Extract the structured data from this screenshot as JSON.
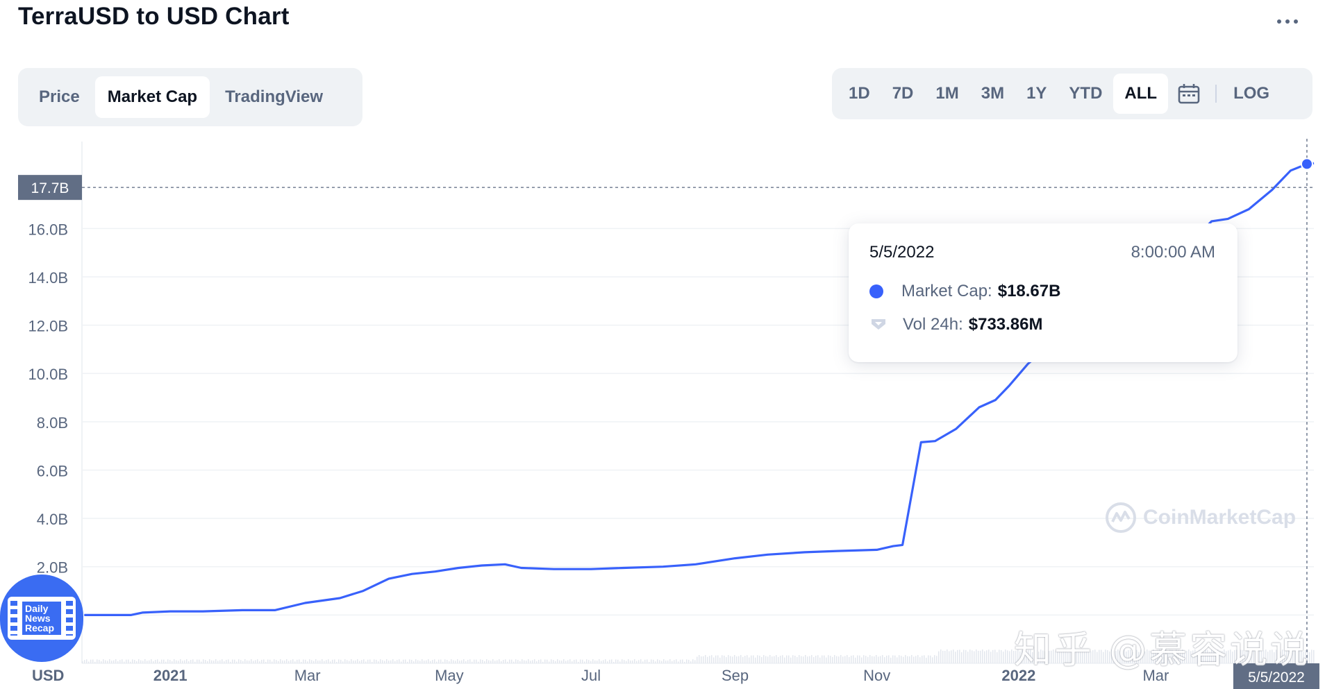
{
  "header": {
    "title": "TerraUSD to USD Chart",
    "more_label": "..."
  },
  "tabs": [
    {
      "label": "Price",
      "active": false
    },
    {
      "label": "Market Cap",
      "active": true
    },
    {
      "label": "TradingView",
      "active": false
    }
  ],
  "ranges": [
    {
      "label": "1D",
      "active": false
    },
    {
      "label": "7D",
      "active": false
    },
    {
      "label": "1M",
      "active": false
    },
    {
      "label": "3M",
      "active": false
    },
    {
      "label": "1Y",
      "active": false
    },
    {
      "label": "YTD",
      "active": false
    },
    {
      "label": "ALL",
      "active": true
    }
  ],
  "log_label": "LOG",
  "tooltip": {
    "date": "5/5/2022",
    "time": "8:00:00 AM",
    "market_cap_label": "Market Cap:",
    "market_cap_value": "$18.67B",
    "vol_label": "Vol 24h:",
    "vol_value": "$733.86M"
  },
  "watermark": "CoinMarketCap",
  "overlay_logo_text": [
    "Daily",
    "News",
    "Recap"
  ],
  "overlay_watermark": "知乎 @慕容说说",
  "colors": {
    "line": "#3861fb",
    "grid": "#eff2f5",
    "axis_text": "#58667e"
  },
  "chart_data": {
    "type": "line",
    "currency_label": "USD",
    "series": [
      {
        "name": "Market Cap",
        "x": [
          "2020-11-25",
          "2020-12-05",
          "2020-12-15",
          "2020-12-20",
          "2021-01-01",
          "2021-01-15",
          "2021-02-01",
          "2021-02-15",
          "2021-02-28",
          "2021-03-15",
          "2021-03-25",
          "2021-04-05",
          "2021-04-15",
          "2021-04-25",
          "2021-05-05",
          "2021-05-15",
          "2021-05-25",
          "2021-06-01",
          "2021-06-15",
          "2021-07-01",
          "2021-07-15",
          "2021-08-01",
          "2021-08-15",
          "2021-09-01",
          "2021-09-15",
          "2021-10-01",
          "2021-10-15",
          "2021-11-01",
          "2021-11-08",
          "2021-11-12",
          "2021-11-20",
          "2021-11-26",
          "2021-12-05",
          "2021-12-15",
          "2021-12-22",
          "2021-12-28",
          "2022-01-05",
          "2022-01-15",
          "2022-01-25",
          "2022-02-05",
          "2022-02-15",
          "2022-02-25",
          "2022-03-05",
          "2022-03-15",
          "2022-03-25",
          "2022-04-01",
          "2022-04-10",
          "2022-04-20",
          "2022-04-28",
          "2022-05-05",
          "2022-05-08"
        ],
        "y": [
          0.0,
          0.0,
          0.0,
          0.1,
          0.15,
          0.15,
          0.2,
          0.2,
          0.5,
          0.7,
          1.0,
          1.5,
          1.7,
          1.8,
          1.95,
          2.05,
          2.1,
          1.95,
          1.9,
          1.9,
          1.95,
          2.0,
          2.1,
          2.35,
          2.5,
          2.6,
          2.65,
          2.7,
          2.85,
          2.9,
          7.15,
          7.2,
          7.7,
          8.6,
          8.9,
          9.5,
          10.4,
          11.2,
          12.0,
          12.8,
          13.6,
          14.2,
          14.8,
          15.3,
          16.3,
          16.4,
          16.8,
          17.6,
          18.4,
          18.67,
          18.7
        ]
      }
    ],
    "y_ticks": [
      "2.0B",
      "4.0B",
      "6.0B",
      "8.0B",
      "10.0B",
      "12.0B",
      "14.0B",
      "16.0B"
    ],
    "y_tick_values": [
      2,
      4,
      6,
      8,
      10,
      12,
      14,
      16
    ],
    "x_ticks": [
      "2021",
      "Mar",
      "May",
      "Jul",
      "Sep",
      "Nov",
      "2022",
      "Mar"
    ],
    "x_tick_dates": [
      "2021-01-01",
      "2021-03-01",
      "2021-05-01",
      "2021-07-01",
      "2021-09-01",
      "2021-11-01",
      "2022-01-01",
      "2022-03-01"
    ],
    "x_tick_bold": [
      true,
      false,
      false,
      false,
      false,
      false,
      true,
      false
    ],
    "x_range": [
      "2020-11-24",
      "2022-05-08"
    ],
    "y_range": [
      -2,
      19.6
    ],
    "crosshair": {
      "x": "2022-05-05",
      "y_label": "17.7B",
      "y": 17.7,
      "x_label": "5/5/2022"
    },
    "grid": true
  }
}
